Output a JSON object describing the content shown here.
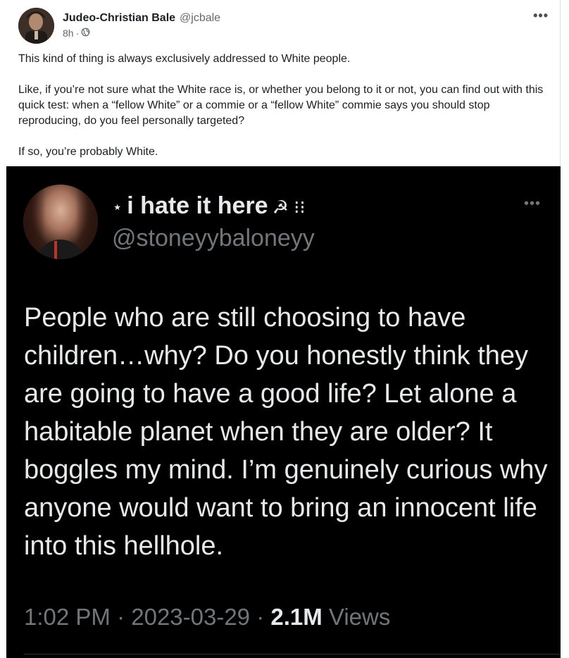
{
  "post": {
    "author_name": "Judeo-Christian Bale",
    "handle": "@jcbale",
    "time": "8h",
    "dot": "·",
    "privacy_icon": "globe-icon",
    "more_label": "•••",
    "paragraphs": [
      "This kind of thing is always exclusively addressed to White people.",
      "Like, if you’re not sure what the White race is, or whether you belong to it or not, you can find out with this quick test: when a “fellow White” or a commie or a “fellow White” commie says you should stop reproducing, do you feel personally targeted?",
      "If so, you’re probably White."
    ]
  },
  "tweet": {
    "star": "⋆",
    "display_name": "i hate it here",
    "name_symbols": "☭ ⁝⁝",
    "handle": "@stoneyybaloneyy",
    "more_label": "•••",
    "text": "People who are still choosing to have children…why? Do you honestly think they are going to have a good life? Let alone a habitable planet when they are older? It boggles my mind. I’m genuinely curious why anyone would want to bring an innocent life into this hellhole.",
    "time": "1:02 PM",
    "date": "2023-03-29",
    "separator": " · ",
    "views_count": "2.1M",
    "views_label": "Views"
  },
  "colors": {
    "tweet_background": "#000000",
    "tweet_text": "#e7e9ea",
    "tweet_secondary": "#71767b",
    "post_text": "#1c1e21",
    "post_secondary": "#65676b"
  }
}
